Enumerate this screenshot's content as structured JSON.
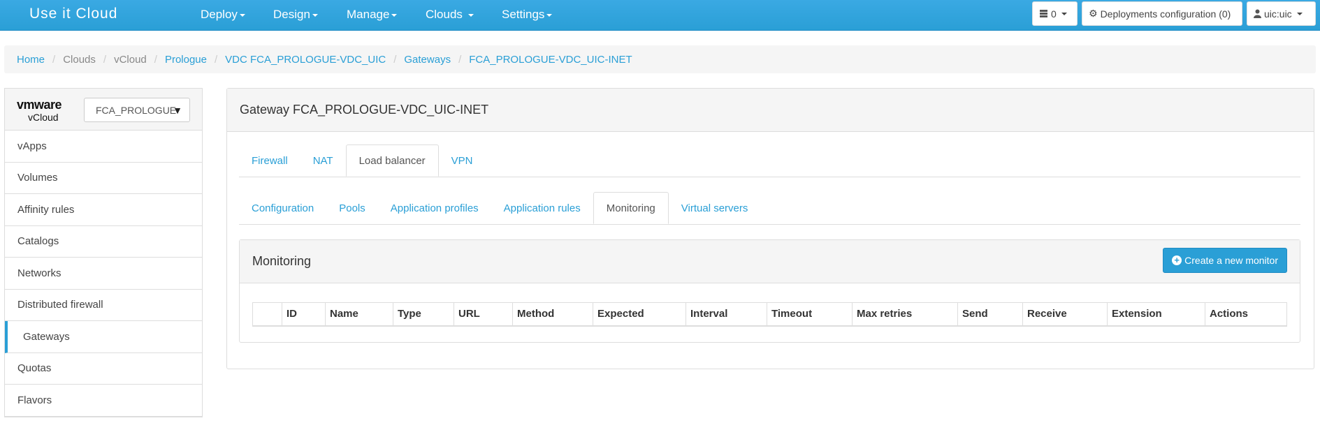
{
  "navbar": {
    "brand": "Use it Cloud",
    "menu": [
      "Deploy",
      "Design",
      "Manage",
      "Clouds ",
      "Settings"
    ],
    "count_label": "0",
    "deployments_label": "Deployments configuration (0)",
    "user_label": "uic:uic"
  },
  "breadcrumb": {
    "home": "Home",
    "clouds": "Clouds",
    "vcloud": "vCloud",
    "prologue": "Prologue",
    "vdc": "VDC FCA_PROLOGUE-VDC_UIC",
    "gateways": "Gateways",
    "current": "FCA_PROLOGUE-VDC_UIC-INET"
  },
  "sidebar": {
    "logo_vmware": "vmware",
    "logo_vcloud": "vCloud",
    "select_value": "FCA_PROLOGUE",
    "items": [
      "vApps",
      "Volumes",
      "Affinity rules",
      "Catalogs",
      "Networks",
      "Distributed firewall",
      "Gateways",
      "Quotas",
      "Flavors"
    ]
  },
  "main": {
    "title": "Gateway FCA_PROLOGUE-VDC_UIC-INET",
    "tabs": [
      "Firewall",
      "NAT",
      "Load balancer",
      "VPN"
    ],
    "subtabs": [
      "Configuration",
      "Pools",
      "Application profiles",
      "Application rules",
      "Monitoring",
      "Virtual servers"
    ],
    "monitoring": {
      "title": "Monitoring",
      "create_button": "Create a new monitor",
      "columns": [
        "",
        "ID",
        "Name",
        "Type",
        "URL",
        "Method",
        "Expected",
        "Interval",
        "Timeout",
        "Max retries",
        "Send",
        "Receive",
        "Extension",
        "Actions"
      ]
    }
  }
}
